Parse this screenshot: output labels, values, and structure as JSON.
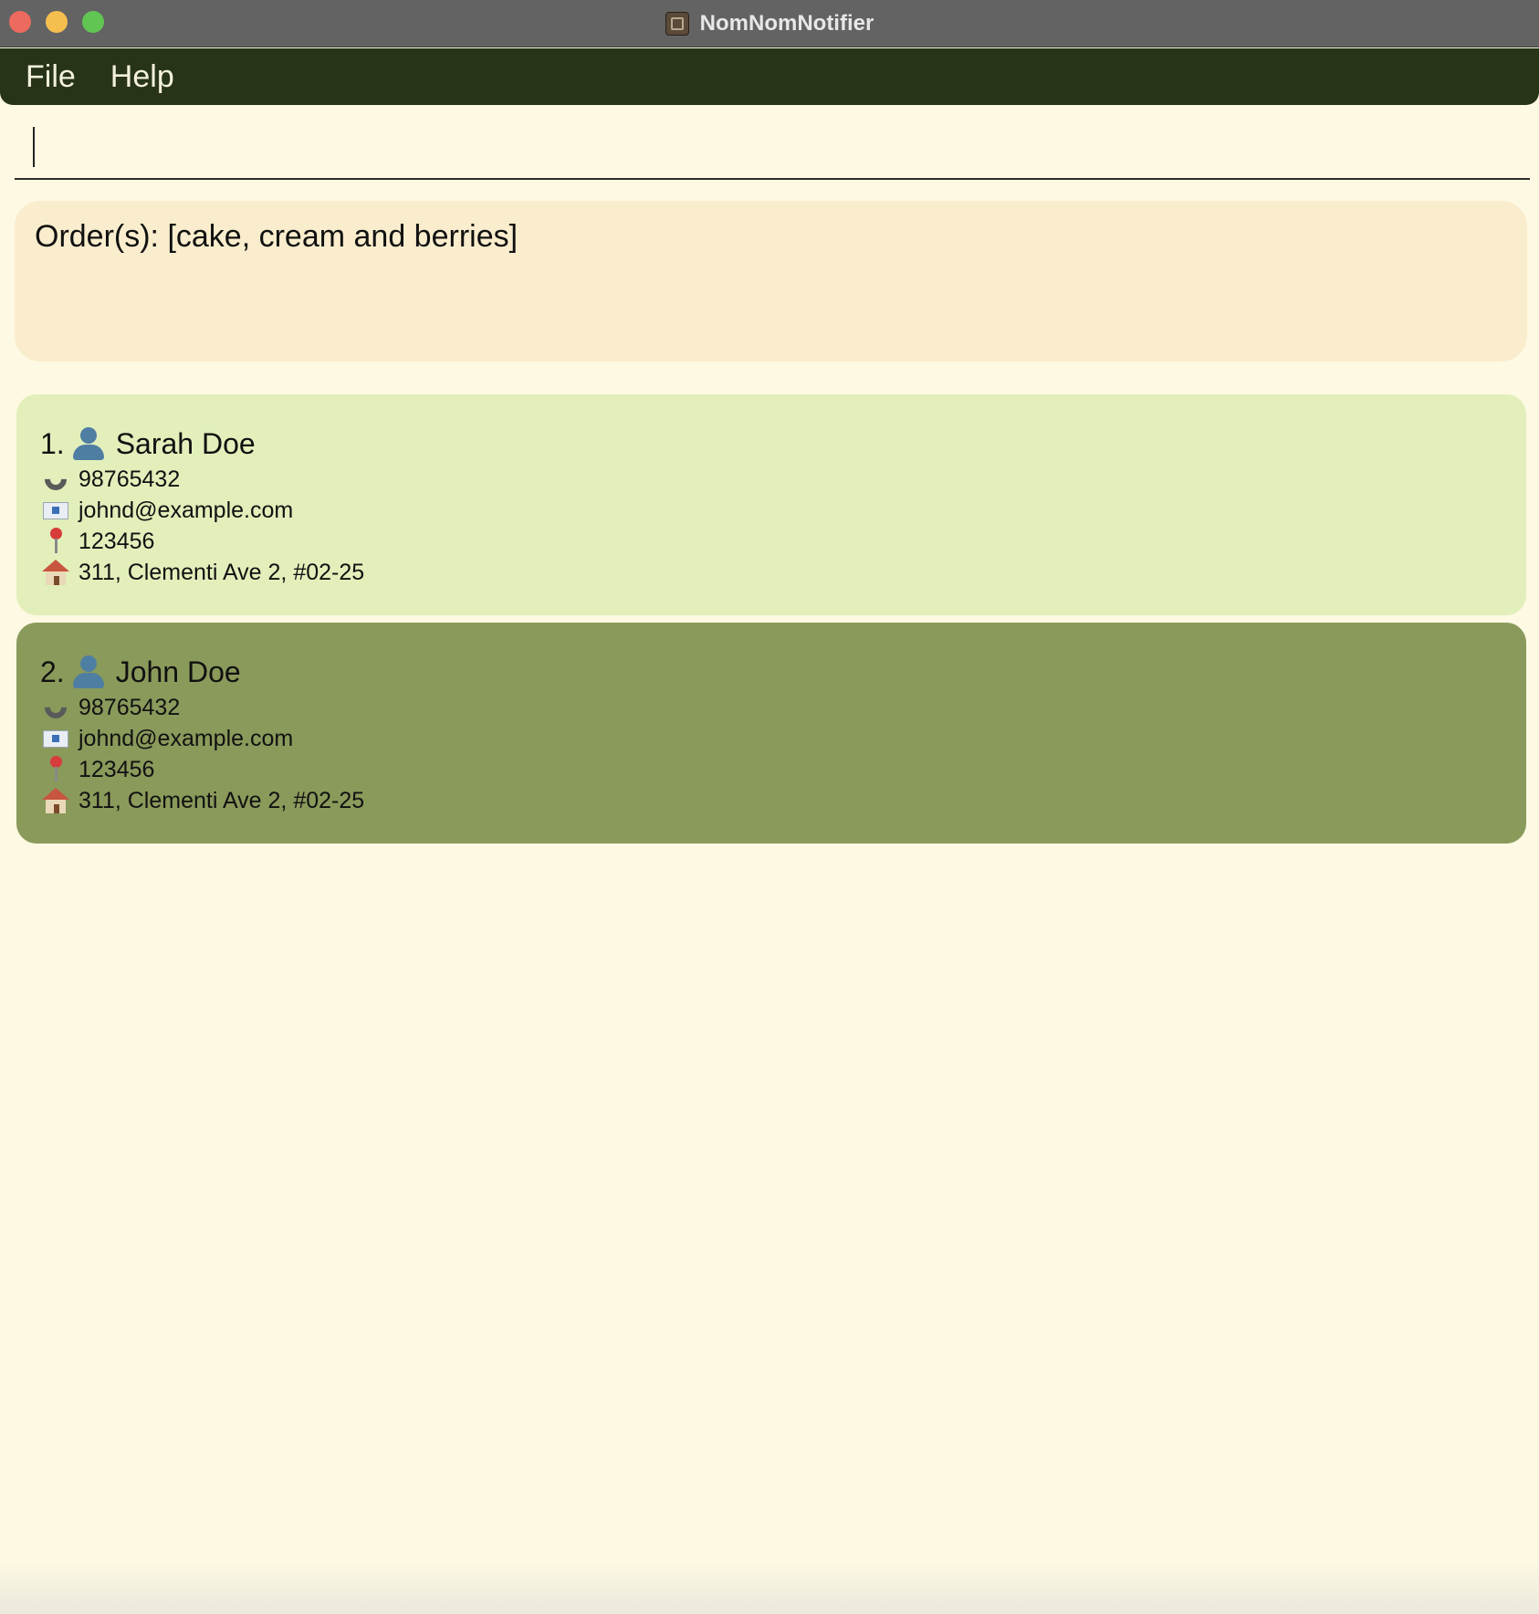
{
  "window": {
    "title": "NomNomNotifier",
    "traffic_colors": {
      "close": "#ed6a5e",
      "minimize": "#f5bf4f",
      "maximize": "#61c554"
    },
    "icon": "app-icon"
  },
  "menu": {
    "items": [
      {
        "label": "File"
      },
      {
        "label": "Help"
      }
    ]
  },
  "command": {
    "value": "",
    "placeholder": ""
  },
  "result": {
    "text": "Order(s): [cake, cream and berries]"
  },
  "persons": [
    {
      "index": "1.",
      "name": "Sarah Doe",
      "phone": "98765432",
      "email": "johnd@example.com",
      "postal": "123456",
      "address": "311, Clementi Ave 2, #02-25",
      "card_color": "#e2efbb"
    },
    {
      "index": "2.",
      "name": "John Doe",
      "phone": "98765432",
      "email": "johnd@example.com",
      "postal": "123456",
      "address": "311, Clementi Ave 2, #02-25",
      "card_color": "#8a9a5b"
    }
  ],
  "colors": {
    "background": "#fef9e2",
    "menubar": "#273417",
    "result_box": "#faedcd"
  }
}
